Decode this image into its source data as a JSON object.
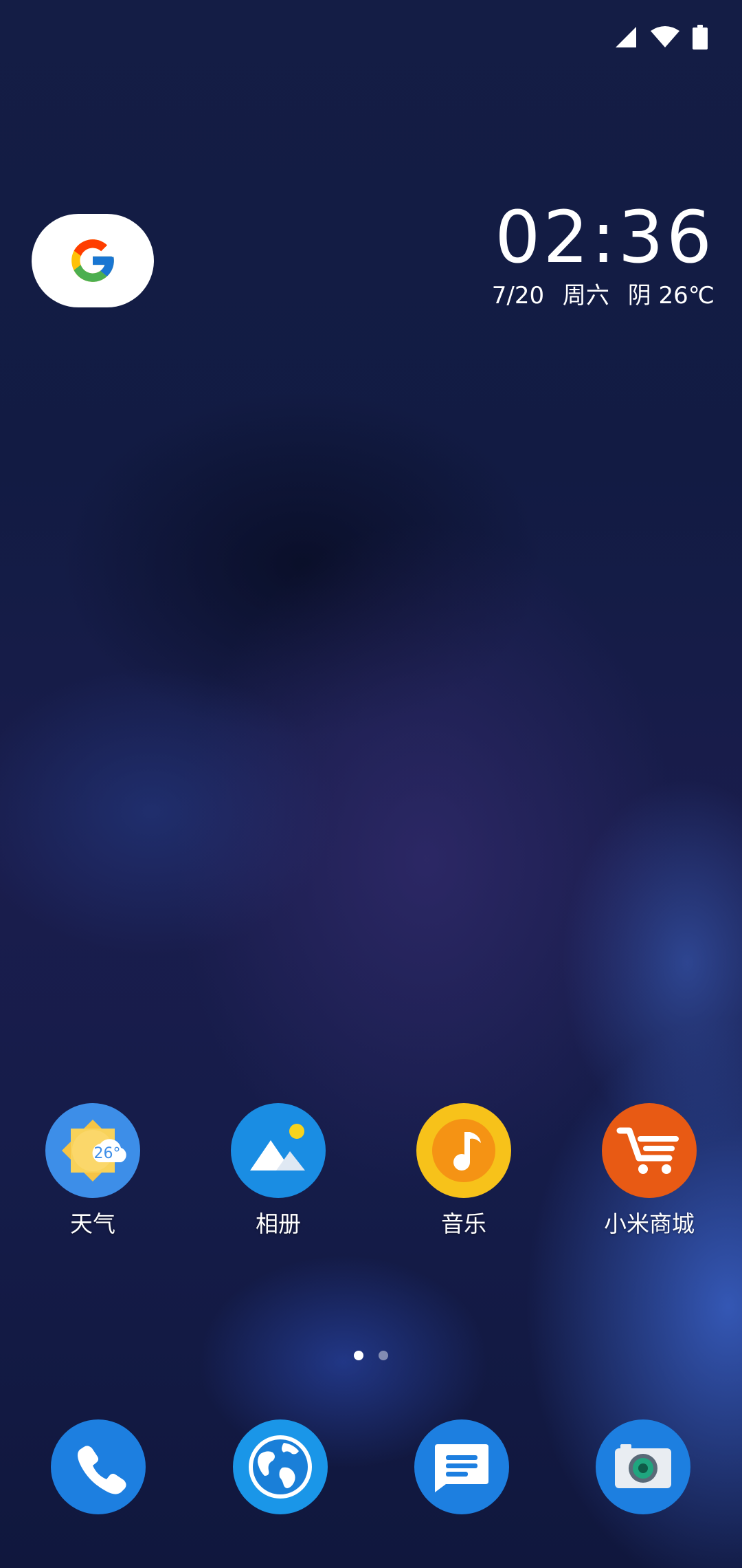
{
  "status_bar": {
    "icons": [
      "cellular-signal-icon",
      "wifi-icon",
      "battery-icon"
    ]
  },
  "search_widget": {
    "icon": "google-g-icon"
  },
  "clock_widget": {
    "time": "02:36",
    "date": "7/20",
    "weekday": "周六",
    "weather": "阴 26℃"
  },
  "apps": [
    {
      "label": "天气",
      "icon": "weather-icon",
      "badge": "26°"
    },
    {
      "label": "相册",
      "icon": "gallery-icon"
    },
    {
      "label": "音乐",
      "icon": "music-icon"
    },
    {
      "label": "小米商城",
      "icon": "mi-store-cart-icon"
    }
  ],
  "page_indicator": {
    "pages": 2,
    "current": 1
  },
  "dock": [
    {
      "icon": "phone-icon"
    },
    {
      "icon": "browser-globe-icon"
    },
    {
      "icon": "messages-icon"
    },
    {
      "icon": "camera-icon"
    }
  ],
  "colors": {
    "weather": "#3d8ee8",
    "gallery": "#1a8de3",
    "music": "#f7c21a",
    "mi_store": "#e85a14",
    "dock_blue": "#1d7fe0",
    "google_blue": "#4285F4",
    "google_red": "#EA4335",
    "google_yellow": "#FBBC05",
    "google_green": "#34A853"
  }
}
